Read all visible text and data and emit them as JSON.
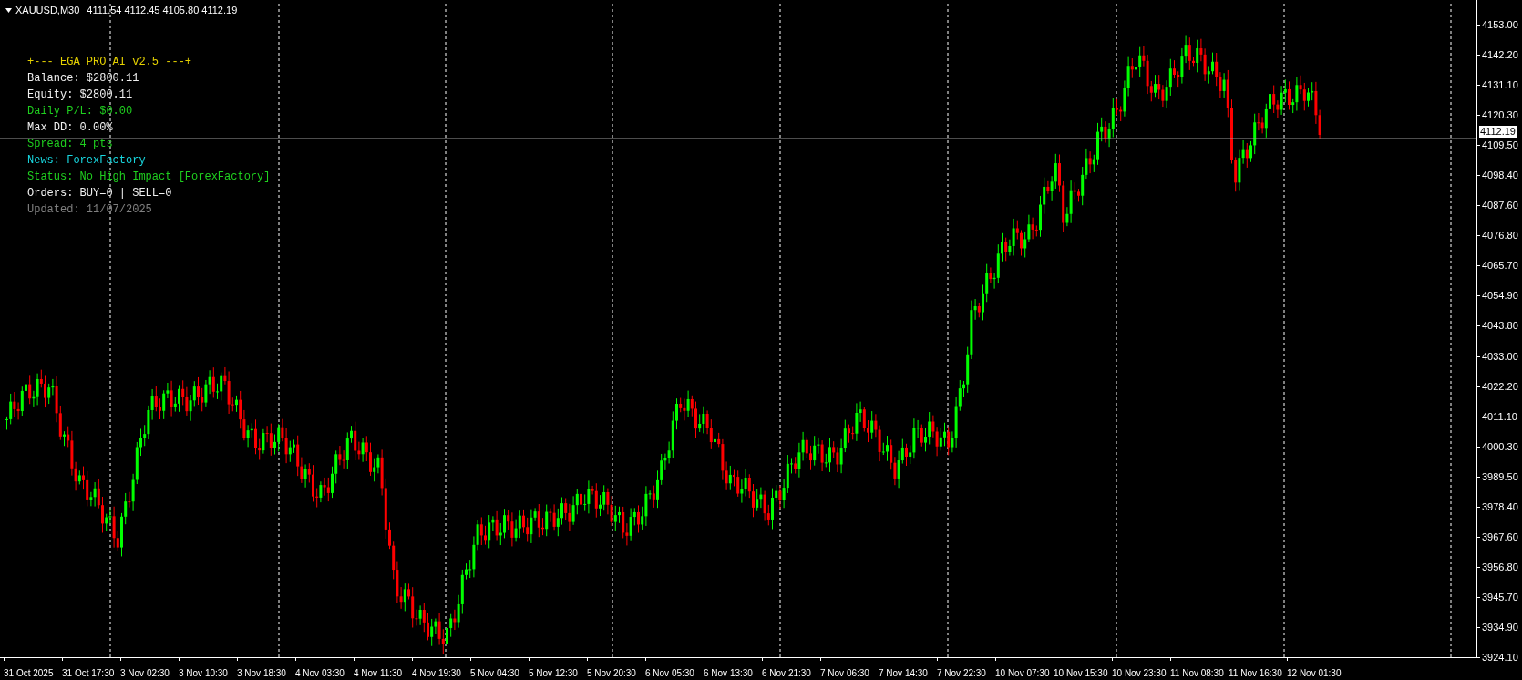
{
  "chart_header": {
    "symbol": "XAUUSD,M30",
    "ohlc": "4111.54 4112.45 4105.80 4112.19"
  },
  "info_panel": [
    {
      "text": "+--- EGA PRO AI v2.5 ---+",
      "color": "#e6d200"
    },
    {
      "text": "Balance: $2800.11",
      "color": "#f0f0f0"
    },
    {
      "text": "Equity: $2800.11",
      "color": "#f0f0f0"
    },
    {
      "text": "Daily P/L: $0.00",
      "color": "#1fd01f"
    },
    {
      "text": "Max DD: 0.00%",
      "color": "#f0f0f0"
    },
    {
      "text": "Spread: 4 pts",
      "color": "#1fd01f"
    },
    {
      "text": "News: ForexFactory",
      "color": "#18d8e0"
    },
    {
      "text": "Status: No High Impact [ForexFactory]",
      "color": "#1fd01f"
    },
    {
      "text": "Orders: BUY=0 | SELL=0",
      "color": "#f0f0f0"
    },
    {
      "text": "Updated: 11/07/2025",
      "color": "#808080"
    }
  ],
  "price_axis": [
    "4153.00",
    "4142.20",
    "4131.10",
    "4120.30",
    "4109.50",
    "4098.40",
    "4087.60",
    "4076.80",
    "4065.70",
    "4054.90",
    "4043.80",
    "4033.00",
    "4022.20",
    "4011.10",
    "4000.30",
    "3989.50",
    "3978.40",
    "3967.60",
    "3956.80",
    "3945.70",
    "3934.90",
    "3924.10"
  ],
  "current_price": "4112.19",
  "time_axis": [
    "31 Oct 2025",
    "31 Oct 17:30",
    "3 Nov 02:30",
    "3 Nov 10:30",
    "3 Nov 18:30",
    "4 Nov 03:30",
    "4 Nov 11:30",
    "4 Nov 19:30",
    "5 Nov 04:30",
    "5 Nov 12:30",
    "5 Nov 20:30",
    "6 Nov 05:30",
    "6 Nov 13:30",
    "6 Nov 21:30",
    "7 Nov 06:30",
    "7 Nov 14:30",
    "7 Nov 22:30",
    "10 Nov 07:30",
    "10 Nov 15:30",
    "10 Nov 23:30",
    "11 Nov 08:30",
    "11 Nov 16:30",
    "12 Nov 01:30"
  ]
}
